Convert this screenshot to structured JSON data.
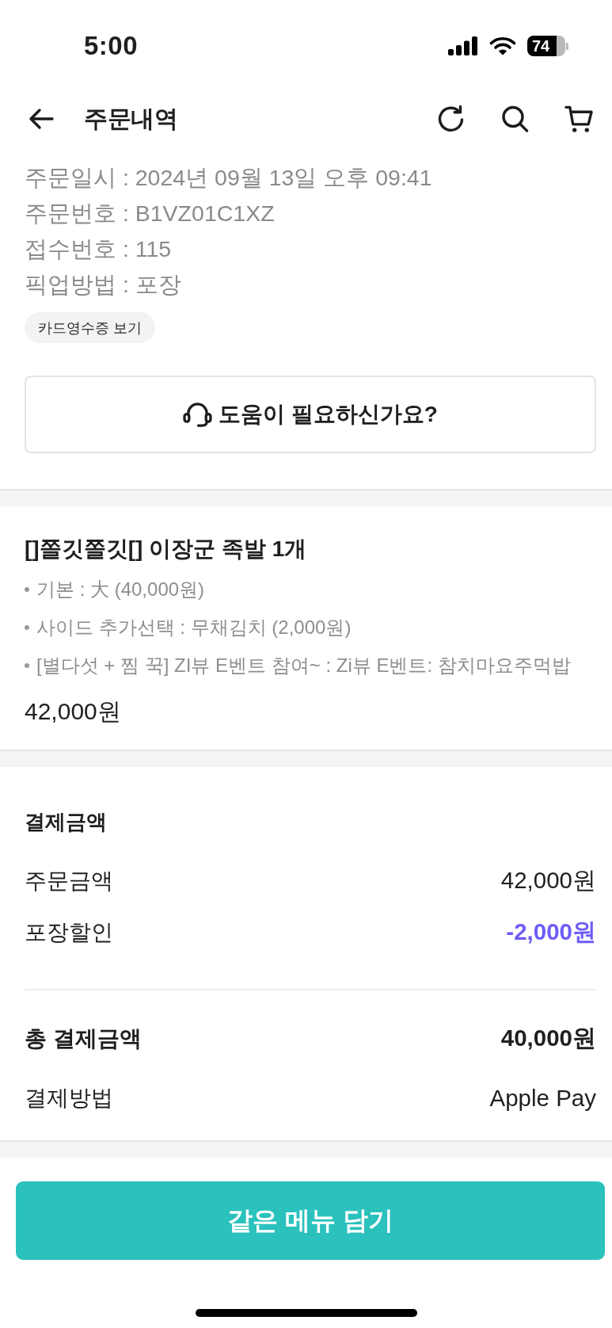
{
  "status_bar": {
    "time": "5:00",
    "battery": "74"
  },
  "header": {
    "title": "주문내역"
  },
  "order_info": {
    "lines": [
      "주문일시 : 2024년 09월 13일 오후 09:41",
      "주문번호 : B1VZ01C1XZ",
      "접수번호 : 115",
      "픽업방법 : 포장"
    ],
    "receipt_button": "카드영수증 보기",
    "help_button": "도움이 필요하신가요?"
  },
  "order_item": {
    "title": "[]쫄깃쫄깃[] 이장군 족발 1개",
    "options": [
      "기본 : 大 (40,000원)",
      "사이드 추가선택 : 무채김치 (2,000원)",
      "[별다섯 + 찜 꾹] ZI뷰 E벤트 참여~ : Zi뷰 E벤트: 참치마요주먹밥"
    ],
    "price": "42,000원"
  },
  "payment": {
    "title": "결제금액",
    "rows": [
      {
        "kind": "plain",
        "label": "주문금액",
        "value": "42,000원"
      },
      {
        "kind": "discount",
        "label": "포장할인",
        "value": "-2,000원"
      }
    ],
    "summary": [
      {
        "kind": "total",
        "label": "총 결제금액",
        "value": "40,000원"
      },
      {
        "kind": "plain",
        "label": "결제방법",
        "value": "Apple Pay"
      }
    ]
  },
  "footer": {
    "button": "같은 메뉴 담기"
  }
}
